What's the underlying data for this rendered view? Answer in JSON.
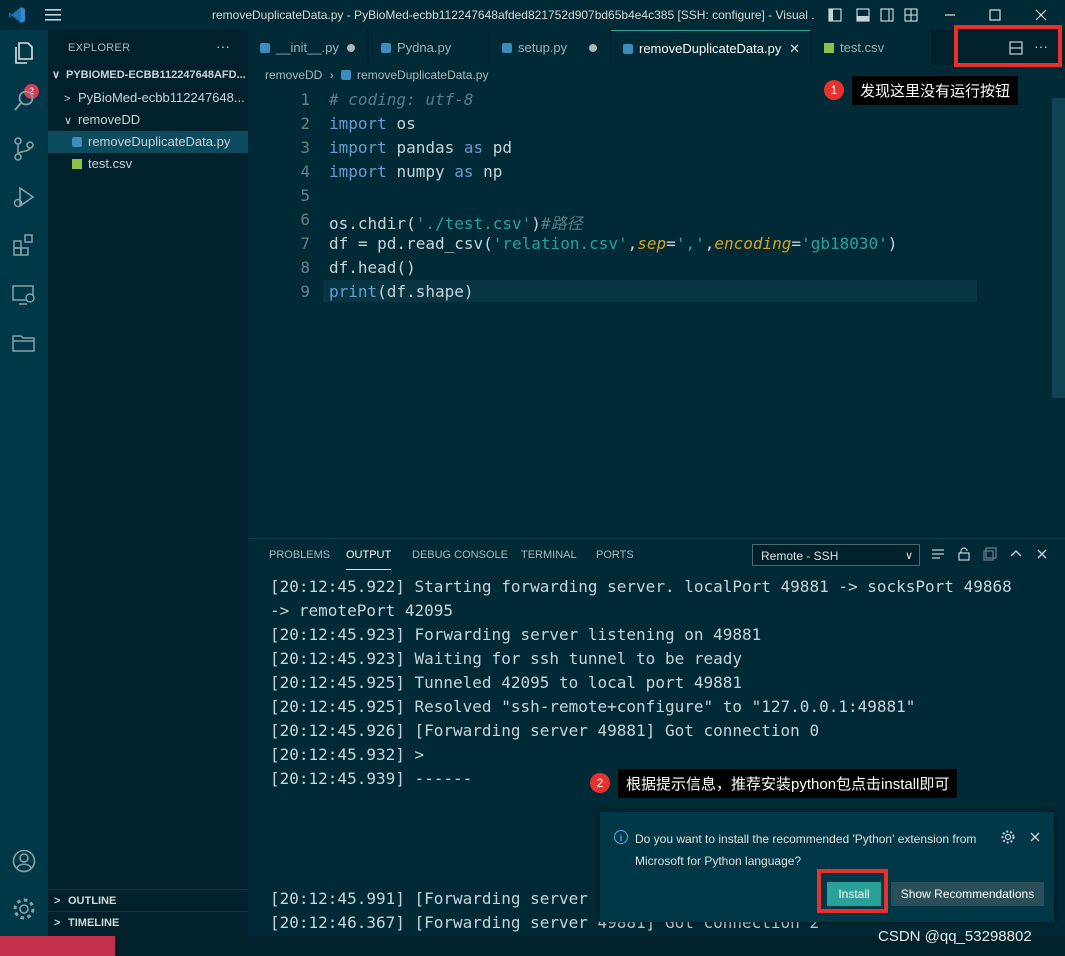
{
  "window": {
    "title": "removeDuplicateData.py - PyBioMed-ecbb112247648afded821752d907bd65b4e4c385 [SSH: configure] - Visual ..."
  },
  "activity": {
    "explorer_badge": "2"
  },
  "sidebar": {
    "title": "EXPLORER",
    "more": "···",
    "root": "PYBIOMED-ECBB112247648AFD...",
    "items": [
      {
        "label": "PyBioMed-ecbb112247648...",
        "chevron": ">"
      },
      {
        "label": "removeDD",
        "chevron": "∨"
      },
      {
        "label": "removeDuplicateData.py"
      },
      {
        "label": "test.csv"
      }
    ],
    "outline": "OUTLINE",
    "timeline": "TIMELINE"
  },
  "tabs": [
    {
      "label": "__init__.py"
    },
    {
      "label": "Pydna.py"
    },
    {
      "label": "setup.py"
    },
    {
      "label": "removeDuplicateData.py"
    },
    {
      "label": "test.csv"
    }
  ],
  "editor_actions": {
    "more": "···"
  },
  "breadcrumb": {
    "folder": "removeDD",
    "file": "removeDuplicateData.py"
  },
  "code": {
    "line_numbers": [
      "1",
      "2",
      "3",
      "4",
      "5",
      "6",
      "7",
      "8",
      "9"
    ],
    "line1": "# coding: utf-8",
    "kw_import": "import",
    "kw_as": "as",
    "os": "os",
    "pandas": "pandas",
    "pd": "pd",
    "numpy": "numpy",
    "np": "np",
    "line6_a": "os.chdir(",
    "line6_b": "'./test.csv'",
    "line6_c": ")",
    "line6_d": "#路径",
    "line7_a": "df = pd.read_csv(",
    "line7_b": "'relation.csv'",
    "line7_c": ",",
    "line7_d": "sep",
    "line7_e": "=",
    "line7_f": "','",
    "line7_g": ",",
    "line7_h": "encoding",
    "line7_i": "=",
    "line7_j": "'gb18030'",
    "line7_k": ")",
    "line8": "df.head()",
    "line9_a": "print",
    "line9_b": "(df.shape)"
  },
  "panel": {
    "tabs": [
      "PROBLEMS",
      "OUTPUT",
      "DEBUG CONSOLE",
      "TERMINAL",
      "PORTS"
    ],
    "channel": "Remote - SSH",
    "lines": [
      "[20:12:45.922] Starting forwarding server. localPort 49881 -> socksPort 49868",
      "-> remotePort 42095",
      "[20:12:45.923] Forwarding server listening on 49881",
      "[20:12:45.923] Waiting for ssh tunnel to be ready",
      "[20:12:45.925] Tunneled 42095 to local port 49881",
      "[20:12:45.925] Resolved \"ssh-remote+configure\" to \"127.0.0.1:49881\"",
      "[20:12:45.926] [Forwarding server 49881] Got connection 0",
      "[20:12:45.932] >",
      "[20:12:45.939] ------",
      "[20:12:45.991] [Forwarding server",
      "[20:12:46.367] [Forwarding server 49881] Got connection 2"
    ]
  },
  "notification": {
    "message": "Do you want to install the recommended 'Python' extension from Microsoft for Python language?",
    "install": "Install",
    "show_recommendations": "Show Recommendations"
  },
  "annotations": {
    "note1_num": "1",
    "note1": "发现这里没有运行按钮",
    "note2_num": "2",
    "note2": "根据提示信息，推荐安装python包点击install即可"
  },
  "watermark": "CSDN @qq_53298802",
  "colors": {
    "background": "#002b36",
    "accent": "#2aa198",
    "annotation_red": "#e8312d"
  }
}
